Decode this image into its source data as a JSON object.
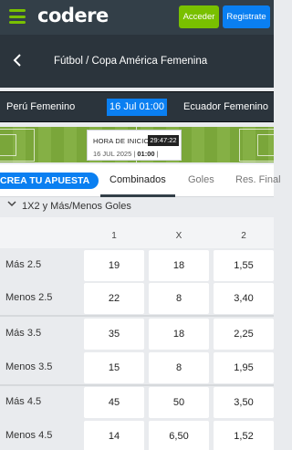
{
  "header": {
    "logo_text": "codere",
    "login_label": "Acceder",
    "register_label": "Registrate"
  },
  "breadcrumb": {
    "text": "Fútbol / Copa América Femenina"
  },
  "match": {
    "home": "Perú Femenino",
    "time": "16 Jul 01:00",
    "away": "Ecuador Femenino"
  },
  "kickoff": {
    "label": "HORA DE INICIO",
    "countdown": "29:47:22",
    "date": "16 JUL 2025",
    "time": "01:00"
  },
  "tabs": {
    "create_bet": "CREA TU APUESTA",
    "items": [
      "Combinados",
      "Goles",
      "Res. Final"
    ],
    "active": "Combinados"
  },
  "market": {
    "title": "1X2 y Más/Menos Goles",
    "columns": [
      "1",
      "X",
      "2"
    ],
    "rows": [
      {
        "label": "Más 2.5",
        "odds": [
          "19",
          "18",
          "1,55"
        ]
      },
      {
        "label": "Menos 2.5",
        "odds": [
          "22",
          "8",
          "3,40"
        ]
      },
      {
        "label": "Más 3.5",
        "odds": [
          "35",
          "18",
          "2,25"
        ]
      },
      {
        "label": "Menos 3.5",
        "odds": [
          "15",
          "8",
          "1,95"
        ]
      },
      {
        "label": "Más 4.5",
        "odds": [
          "45",
          "50",
          "3,50"
        ]
      },
      {
        "label": "Menos 4.5",
        "odds": [
          "14",
          "6,50",
          "1,52"
        ]
      }
    ]
  },
  "colors": {
    "topbar": "#333f48",
    "brand_green": "#79c000",
    "accent_blue": "#0a7ff1",
    "dark_bar": "#2b343c"
  }
}
